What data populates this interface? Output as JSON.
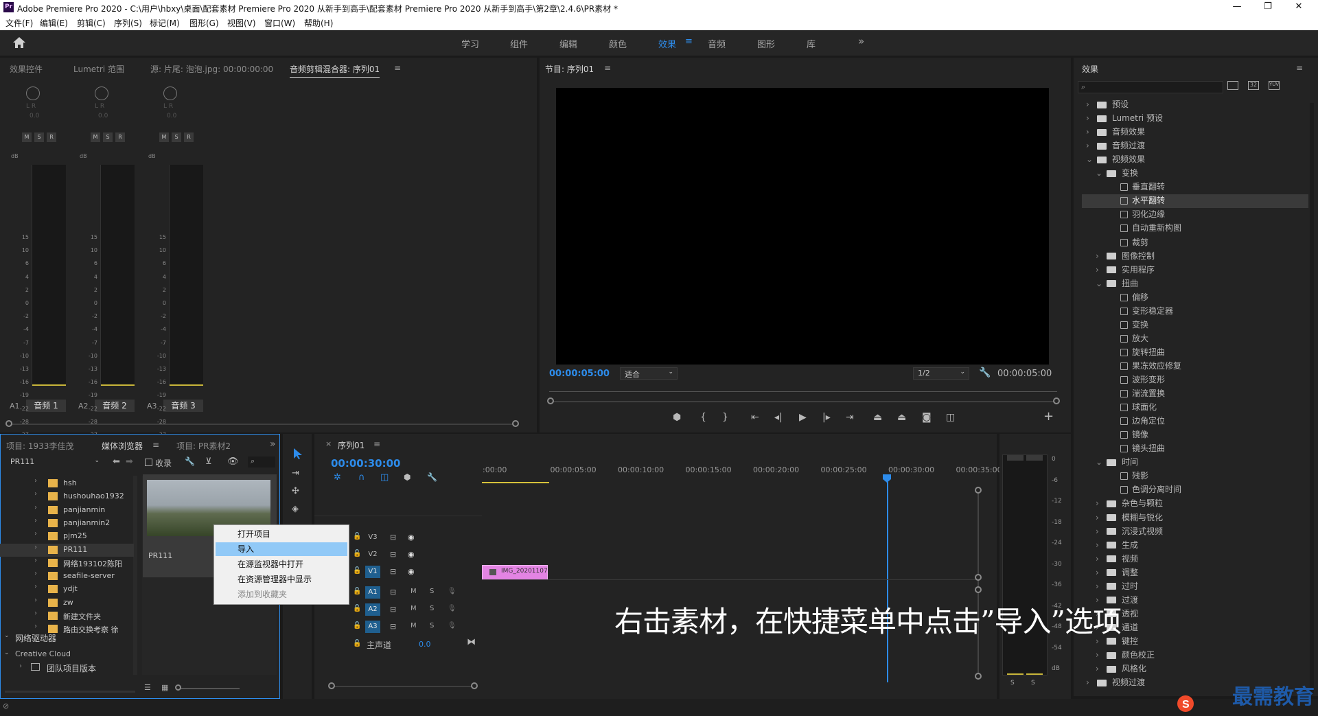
{
  "window": {
    "title": "Adobe Premiere Pro 2020 - C:\\用户\\hbxy\\桌面\\配套素材 Premiere Pro 2020 从新手到高手\\配套素材 Premiere Pro 2020 从新手到高手\\第2章\\2.4.6\\PR素材 *",
    "logo_text": "Pr",
    "controls": [
      "—",
      "❐",
      "✕"
    ]
  },
  "menu": [
    "文件(F)",
    "编辑(E)",
    "剪辑(C)",
    "序列(S)",
    "标记(M)",
    "图形(G)",
    "视图(V)",
    "窗口(W)",
    "帮助(H)"
  ],
  "workspaces": {
    "tabs": [
      "学习",
      "组件",
      "编辑",
      "颜色",
      "效果",
      "音频",
      "图形",
      "库"
    ],
    "active": "效果",
    "more": "»"
  },
  "source_panel": {
    "tabs": [
      "效果控件",
      "Lumetri 范围",
      "源: 片尾: 泡泡.jpg: 00:00:00:00",
      "音频剪辑混合器: 序列01"
    ],
    "active_tab": "音频剪辑混合器: 序列01",
    "channels": [
      {
        "id": "A1",
        "name": "音频 1",
        "value": "0.0"
      },
      {
        "id": "A2",
        "name": "音频 2",
        "value": "0.0"
      },
      {
        "id": "A3",
        "name": "音频 3",
        "value": "0.0"
      }
    ],
    "msr": [
      "M",
      "S",
      "R"
    ],
    "lr": "L R",
    "db_label": "dB",
    "scale": [
      "15",
      "10",
      "6",
      "4",
      "2",
      "0",
      "-2",
      "-4",
      "-7",
      "-10",
      "-13",
      "-16",
      "-19",
      "-22",
      "-28",
      "-37",
      "-∞"
    ]
  },
  "program_monitor": {
    "title": "节目: 序列01",
    "timecode_left": "00:00:05:00",
    "fit": "适合",
    "resolution": "1/2",
    "timecode_right": "00:00:05:00"
  },
  "effects_panel": {
    "title": "效果",
    "search_placeholder": "",
    "items": [
      {
        "level": 0,
        "type": "folder",
        "open": false,
        "label": "预设"
      },
      {
        "level": 0,
        "type": "folder",
        "open": false,
        "label": "Lumetri 预设"
      },
      {
        "level": 0,
        "type": "folder",
        "open": false,
        "label": "音频效果"
      },
      {
        "level": 0,
        "type": "folder",
        "open": false,
        "label": "音频过渡"
      },
      {
        "level": 0,
        "type": "folder",
        "open": true,
        "label": "视频效果"
      },
      {
        "level": 1,
        "type": "folder",
        "open": true,
        "label": "变换"
      },
      {
        "level": 2,
        "type": "effect",
        "label": "垂直翻转"
      },
      {
        "level": 2,
        "type": "effect",
        "label": "水平翻转",
        "selected": true
      },
      {
        "level": 2,
        "type": "effect",
        "label": "羽化边缘"
      },
      {
        "level": 2,
        "type": "effect",
        "label": "自动重新构图"
      },
      {
        "level": 2,
        "type": "effect",
        "label": "裁剪"
      },
      {
        "level": 1,
        "type": "folder",
        "open": false,
        "label": "图像控制"
      },
      {
        "level": 1,
        "type": "folder",
        "open": false,
        "label": "实用程序"
      },
      {
        "level": 1,
        "type": "folder",
        "open": true,
        "label": "扭曲"
      },
      {
        "level": 2,
        "type": "effect",
        "label": "偏移"
      },
      {
        "level": 2,
        "type": "effect",
        "label": "变形稳定器"
      },
      {
        "level": 2,
        "type": "effect",
        "label": "变换"
      },
      {
        "level": 2,
        "type": "effect",
        "label": "放大"
      },
      {
        "level": 2,
        "type": "effect",
        "label": "旋转扭曲"
      },
      {
        "level": 2,
        "type": "effect",
        "label": "果冻效应修复"
      },
      {
        "level": 2,
        "type": "effect",
        "label": "波形变形"
      },
      {
        "level": 2,
        "type": "effect",
        "label": "湍流置换"
      },
      {
        "level": 2,
        "type": "effect",
        "label": "球面化"
      },
      {
        "level": 2,
        "type": "effect",
        "label": "边角定位"
      },
      {
        "level": 2,
        "type": "effect",
        "label": "镜像"
      },
      {
        "level": 2,
        "type": "effect",
        "label": "镜头扭曲"
      },
      {
        "level": 1,
        "type": "folder",
        "open": true,
        "label": "时间"
      },
      {
        "level": 2,
        "type": "effect",
        "label": "残影"
      },
      {
        "level": 2,
        "type": "effect",
        "label": "色调分离时间"
      },
      {
        "level": 1,
        "type": "folder",
        "open": false,
        "label": "杂色与颗粒"
      },
      {
        "level": 1,
        "type": "folder",
        "open": false,
        "label": "模糊与锐化"
      },
      {
        "level": 1,
        "type": "folder",
        "open": false,
        "label": "沉浸式视频"
      },
      {
        "level": 1,
        "type": "folder",
        "open": false,
        "label": "生成"
      },
      {
        "level": 1,
        "type": "folder",
        "open": false,
        "label": "视频"
      },
      {
        "level": 1,
        "type": "folder",
        "open": false,
        "label": "调整"
      },
      {
        "level": 1,
        "type": "folder",
        "open": false,
        "label": "过时"
      },
      {
        "level": 1,
        "type": "folder",
        "open": false,
        "label": "过渡"
      },
      {
        "level": 1,
        "type": "folder",
        "open": false,
        "label": "透视"
      },
      {
        "level": 1,
        "type": "folder",
        "open": false,
        "label": "通道"
      },
      {
        "level": 1,
        "type": "folder",
        "open": false,
        "label": "键控"
      },
      {
        "level": 1,
        "type": "folder",
        "open": false,
        "label": "颜色校正"
      },
      {
        "level": 1,
        "type": "folder",
        "open": false,
        "label": "风格化"
      },
      {
        "level": 0,
        "type": "folder",
        "open": false,
        "label": "视频过渡"
      }
    ]
  },
  "project_panel": {
    "tabs": [
      "项目: 1933李佳茂",
      "媒体浏览器",
      "项目: PR素材2"
    ],
    "active_tab": "媒体浏览器",
    "location": "PR111",
    "ingest_label": "收录",
    "tree": [
      {
        "label": "hsh"
      },
      {
        "label": "hushouhao1932"
      },
      {
        "label": "panjianmin"
      },
      {
        "label": "panjianmin2"
      },
      {
        "label": "pjm25"
      },
      {
        "label": "PR111",
        "selected": true
      },
      {
        "label": "网络193102陈阳"
      },
      {
        "label": "seafile-server"
      },
      {
        "label": "ydjt"
      },
      {
        "label": "zw"
      },
      {
        "label": "新建文件夹"
      },
      {
        "label": "路由交换考察 徐"
      }
    ],
    "network_drives": "网络驱动器",
    "creative_cloud": "Creative Cloud",
    "team_projects": "团队项目版本",
    "thumb_label": "PR111"
  },
  "context_menu": {
    "items": [
      {
        "label": "打开项目",
        "state": "normal"
      },
      {
        "label": "导入",
        "state": "highlighted"
      },
      {
        "label": "在源监视器中打开",
        "state": "normal"
      },
      {
        "label": "在资源管理器中显示",
        "state": "normal"
      },
      {
        "label": "添加到收藏夹",
        "state": "disabled"
      }
    ]
  },
  "timeline": {
    "tab": "序列01",
    "timecode": "00:00:30:00",
    "ruler": [
      ":00:00",
      "00:00:05:00",
      "00:00:10:00",
      "00:00:15:00",
      "00:00:20:00",
      "00:00:25:00",
      "00:00:30:00",
      "00:00:35:00"
    ],
    "video_tracks": [
      "V3",
      "V2",
      "V1"
    ],
    "audio_tracks": [
      "A1",
      "A2",
      "A3"
    ],
    "master_label": "主声道",
    "master_value": "0.0",
    "clip_label": "IMG_20201107",
    "track_buttons": [
      "M",
      "S"
    ]
  },
  "audio_meter": {
    "scale": [
      "0",
      "-6",
      "-12",
      "-18",
      "-24",
      "-30",
      "-36",
      "-42",
      "-48",
      "-54",
      "dB"
    ],
    "solo": [
      "S",
      "S"
    ]
  },
  "overlay": {
    "caption": "右击素材，在快捷菜单中点击”导入”选项",
    "watermark": "最需教育"
  },
  "colors": {
    "accent_blue": "#2d8ceb",
    "clip_pink": "#e384e3",
    "menu_highlight": "#91c9f7",
    "folder_yellow": "#e8b34a"
  }
}
